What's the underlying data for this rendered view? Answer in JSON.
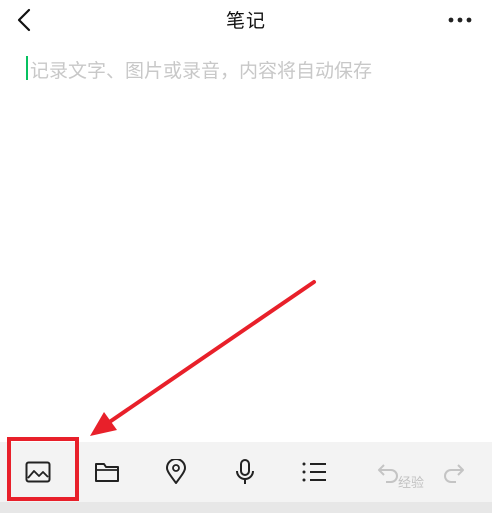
{
  "header": {
    "title": "笔记"
  },
  "editor": {
    "placeholder": "记录文字、图片或录音，内容将自动保存"
  },
  "toolbar": {
    "tools": [
      {
        "icon": "image-icon"
      },
      {
        "icon": "folder-icon"
      },
      {
        "icon": "location-pin-icon"
      },
      {
        "icon": "microphone-icon"
      },
      {
        "icon": "list-icon"
      },
      {
        "icon": "undo-icon"
      },
      {
        "icon": "redo-icon"
      }
    ]
  },
  "annotation": {
    "color": "#e8202a"
  },
  "watermark": {
    "text": "经验"
  },
  "colors": {
    "caret": "#07c160",
    "toolbar_bg": "#f3f3f3"
  }
}
